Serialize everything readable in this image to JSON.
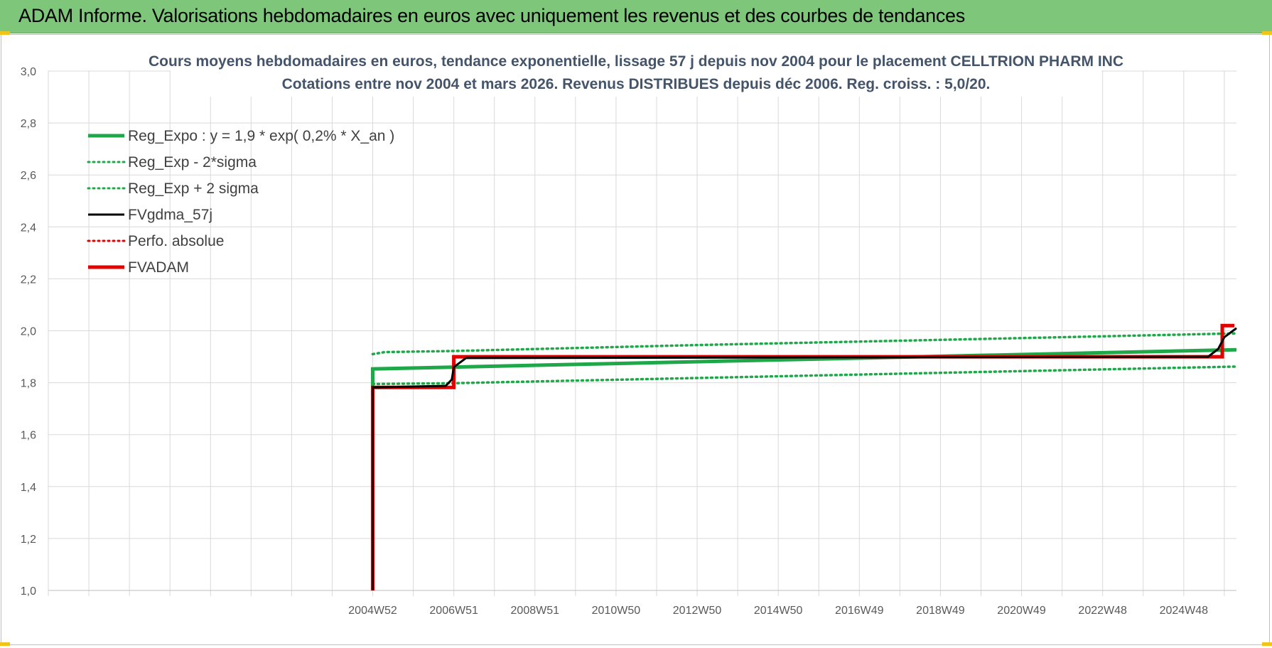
{
  "header": {
    "title": "ADAM Informe. Valorisations hebdomadaires en euros avec uniquement les revenus et des courbes de tendances"
  },
  "chart_data": {
    "type": "line",
    "title_line1": "Cours moyens hebdomadaires en euros, tendance exponentielle, lissage 57 j depuis nov 2004  pour le placement CELLTRION PHARM INC",
    "title_line2": "Cotations entre nov 2004 et mars 2026. Revenus DISTRIBUES depuis déc 2006.  Reg. croiss. : 5,0/20.",
    "ylim": [
      1.0,
      3.0
    ],
    "yticks": [
      "1,0",
      "1,2",
      "1,4",
      "1,6",
      "1,8",
      "2,0",
      "2,2",
      "2,4",
      "2,6",
      "2,8",
      "3,0"
    ],
    "xlim": [
      1997.0,
      2026.3
    ],
    "xticks": [
      {
        "label": "2004W52",
        "x": 2005.0
      },
      {
        "label": "2006W51",
        "x": 2007.0
      },
      {
        "label": "2008W51",
        "x": 2009.0
      },
      {
        "label": "2010W50",
        "x": 2011.0
      },
      {
        "label": "2012W50",
        "x": 2013.0
      },
      {
        "label": "2014W50",
        "x": 2015.0
      },
      {
        "label": "2016W49",
        "x": 2017.0
      },
      {
        "label": "2018W49",
        "x": 2019.0
      },
      {
        "label": "2020W49",
        "x": 2021.0
      },
      {
        "label": "2022W48",
        "x": 2023.0
      },
      {
        "label": "2024W48",
        "x": 2025.0
      }
    ],
    "grid": true,
    "legend_position": "top-left",
    "series": [
      {
        "name": "Reg_Expo : y = 1,9 * exp( 0,2% *  X_an )",
        "color": "#1fa84a",
        "style": "solid",
        "points": [
          [
            2005.0,
            1.0
          ],
          [
            2005.0,
            1.853
          ],
          [
            2026.3,
            1.927
          ]
        ]
      },
      {
        "name": "Reg_Exp - 2*sigma",
        "color": "#1fa84a",
        "style": "dotted",
        "points": [
          [
            2005.0,
            1.795
          ],
          [
            2007.0,
            1.798
          ],
          [
            2013.0,
            1.818
          ],
          [
            2019.0,
            1.838
          ],
          [
            2026.3,
            1.862
          ]
        ]
      },
      {
        "name": "Reg_Exp + 2 sigma",
        "color": "#1fa84a",
        "style": "dotted",
        "points": [
          [
            2005.0,
            1.91
          ],
          [
            2005.3,
            1.918
          ],
          [
            2007.0,
            1.922
          ],
          [
            2013.0,
            1.945
          ],
          [
            2019.0,
            1.965
          ],
          [
            2026.3,
            1.99
          ]
        ]
      },
      {
        "name": "FVgdma_57j",
        "color": "#000000",
        "style": "solid",
        "points": [
          [
            2005.0,
            1.0
          ],
          [
            2005.0,
            1.782
          ],
          [
            2006.8,
            1.788
          ],
          [
            2006.95,
            1.812
          ],
          [
            2007.0,
            1.86
          ],
          [
            2007.3,
            1.895
          ],
          [
            2025.6,
            1.9
          ],
          [
            2025.85,
            1.93
          ],
          [
            2026.0,
            1.975
          ],
          [
            2026.3,
            2.01
          ]
        ]
      },
      {
        "name": "Perfo. absolue",
        "color": "#e00000",
        "style": "dotted",
        "points": [
          [
            2005.0,
            1.782
          ],
          [
            2007.0,
            1.782
          ],
          [
            2007.0,
            1.9
          ],
          [
            2025.9,
            1.9
          ]
        ]
      },
      {
        "name": "FVADAM",
        "color": "#e00000",
        "style": "solid",
        "points": [
          [
            2005.0,
            1.0
          ],
          [
            2005.0,
            1.782
          ],
          [
            2007.0,
            1.782
          ],
          [
            2007.0,
            1.9
          ],
          [
            2025.95,
            1.9
          ],
          [
            2025.95,
            2.02
          ],
          [
            2026.25,
            2.02
          ]
        ]
      }
    ]
  }
}
